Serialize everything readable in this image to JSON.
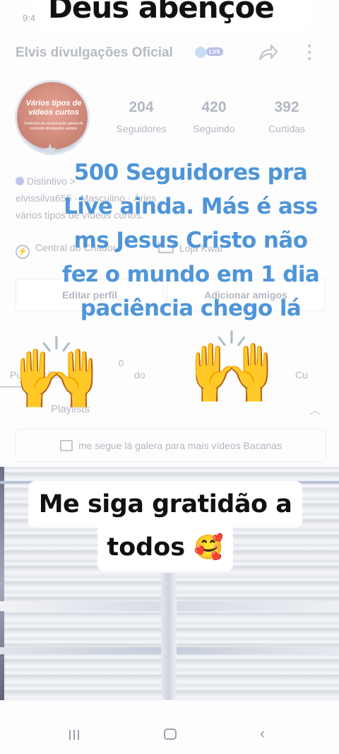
{
  "status_time": "9:4",
  "top_caption": "Deus abençoe",
  "header": {
    "name": "Elvis divulgações Oficial",
    "level_badge": "LV6",
    "share_icon": "share-icon",
    "more_icon": "more-vert-icon"
  },
  "avatar": {
    "line1": "Vários tipos de vídeos curtos",
    "line2": "Destinado de comunicação galeria de conteúdo divulgações sempre"
  },
  "stats": [
    {
      "value": "204",
      "label": "Seguidores"
    },
    {
      "value": "420",
      "label": "Seguindo"
    },
    {
      "value": "392",
      "label": "Curtidas"
    }
  ],
  "profile": {
    "badge_label": "Distintivo >",
    "info": "elvissilva655 · Masculino · Áries",
    "bio": "vários tipos de vídeos curtos."
  },
  "tools": {
    "creator_center": "Central do Criador",
    "kwai_shop": "Loja Kwai"
  },
  "buttons": {
    "edit_profile": "Editar perfil",
    "add_friends": "Adicionar amigos"
  },
  "tabs": {
    "publications": "Publicações",
    "liked": "do",
    "other": "Cu"
  },
  "tab_counts": {
    "c1": "0",
    "c2": "0"
  },
  "playlists": {
    "label": "Playlists",
    "promo": "me segue lá galera para mais vídeos Bacanas"
  },
  "overlay_lines": [
    "500 Seguidores pra",
    "Live ainda. Más é ass",
    "ms Jesus Cristo não",
    "fez o mundo em 1 dia",
    "paciência chego lá"
  ],
  "hands_emoji": "🙌",
  "caption": {
    "line1": "Me siga gratidão a",
    "line2": "todos",
    "emoji": "🥰"
  },
  "colors": {
    "overlay_blue": "#4f95d8",
    "faded_text": "#b3b7c1"
  }
}
